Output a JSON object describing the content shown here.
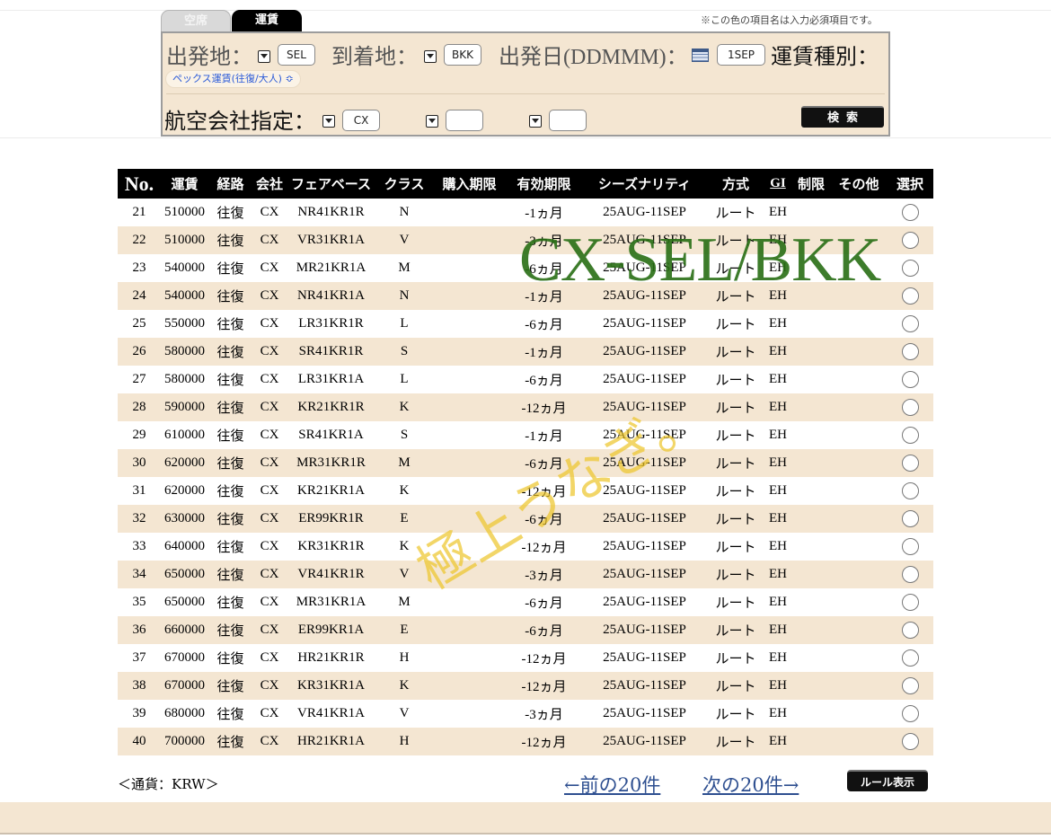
{
  "tabs": {
    "seat": "空席",
    "fare": "運賃"
  },
  "required_note": "※この色の項目名は入力必須項目です。",
  "form": {
    "origin_label": "出発地：",
    "origin_value": "SEL",
    "destination_label": "到着地：",
    "destination_value": "BKK",
    "date_label": "出発日(DDMMM)：",
    "date_value": "1SEP",
    "fare_type_label": "運賃種別：",
    "fare_type_value": "ペックス運賃(往復/大人) ≎",
    "airline_label": "航空会社指定：",
    "airline_1": "CX",
    "airline_2": "",
    "airline_3": "",
    "search_label": "検索"
  },
  "table": {
    "headers": [
      "No.",
      "運賃",
      "経路",
      "会社",
      "フェアベース",
      "クラス",
      "購入期限",
      "有効期限",
      "シーズナリティ",
      "方式",
      "GI",
      "制限",
      "その他",
      "選択"
    ],
    "rows": [
      [
        "21",
        "510000",
        "往復",
        "CX",
        "NR41KR1R",
        "N",
        "",
        "-1ヵ月",
        "25AUG-11SEP",
        "ルート",
        "EH",
        "",
        ""
      ],
      [
        "22",
        "510000",
        "往復",
        "CX",
        "VR31KR1A",
        "V",
        "",
        "-3ヵ月",
        "25AUG-11SEP",
        "ルート",
        "EH",
        "",
        ""
      ],
      [
        "23",
        "540000",
        "往復",
        "CX",
        "MR21KR1A",
        "M",
        "",
        "-6ヵ月",
        "25AUG-11SEP",
        "ルート",
        "EH",
        "",
        ""
      ],
      [
        "24",
        "540000",
        "往復",
        "CX",
        "NR41KR1A",
        "N",
        "",
        "-1ヵ月",
        "25AUG-11SEP",
        "ルート",
        "EH",
        "",
        ""
      ],
      [
        "25",
        "550000",
        "往復",
        "CX",
        "LR31KR1R",
        "L",
        "",
        "-6ヵ月",
        "25AUG-11SEP",
        "ルート",
        "EH",
        "",
        ""
      ],
      [
        "26",
        "580000",
        "往復",
        "CX",
        "SR41KR1R",
        "S",
        "",
        "-1ヵ月",
        "25AUG-11SEP",
        "ルート",
        "EH",
        "",
        ""
      ],
      [
        "27",
        "580000",
        "往復",
        "CX",
        "LR31KR1A",
        "L",
        "",
        "-6ヵ月",
        "25AUG-11SEP",
        "ルート",
        "EH",
        "",
        ""
      ],
      [
        "28",
        "590000",
        "往復",
        "CX",
        "KR21KR1R",
        "K",
        "",
        "-12ヵ月",
        "25AUG-11SEP",
        "ルート",
        "EH",
        "",
        ""
      ],
      [
        "29",
        "610000",
        "往復",
        "CX",
        "SR41KR1A",
        "S",
        "",
        "-1ヵ月",
        "25AUG-11SEP",
        "ルート",
        "EH",
        "",
        ""
      ],
      [
        "30",
        "620000",
        "往復",
        "CX",
        "MR31KR1R",
        "M",
        "",
        "-6ヵ月",
        "25AUG-11SEP",
        "ルート",
        "EH",
        "",
        ""
      ],
      [
        "31",
        "620000",
        "往復",
        "CX",
        "KR21KR1A",
        "K",
        "",
        "-12ヵ月",
        "25AUG-11SEP",
        "ルート",
        "EH",
        "",
        ""
      ],
      [
        "32",
        "630000",
        "往復",
        "CX",
        "ER99KR1R",
        "E",
        "",
        "-6ヵ月",
        "25AUG-11SEP",
        "ルート",
        "EH",
        "",
        ""
      ],
      [
        "33",
        "640000",
        "往復",
        "CX",
        "KR31KR1R",
        "K",
        "",
        "-12ヵ月",
        "25AUG-11SEP",
        "ルート",
        "EH",
        "",
        ""
      ],
      [
        "34",
        "650000",
        "往復",
        "CX",
        "VR41KR1R",
        "V",
        "",
        "-3ヵ月",
        "25AUG-11SEP",
        "ルート",
        "EH",
        "",
        ""
      ],
      [
        "35",
        "650000",
        "往復",
        "CX",
        "MR31KR1A",
        "M",
        "",
        "-6ヵ月",
        "25AUG-11SEP",
        "ルート",
        "EH",
        "",
        ""
      ],
      [
        "36",
        "660000",
        "往復",
        "CX",
        "ER99KR1A",
        "E",
        "",
        "-6ヵ月",
        "25AUG-11SEP",
        "ルート",
        "EH",
        "",
        ""
      ],
      [
        "37",
        "670000",
        "往復",
        "CX",
        "HR21KR1R",
        "H",
        "",
        "-12ヵ月",
        "25AUG-11SEP",
        "ルート",
        "EH",
        "",
        ""
      ],
      [
        "38",
        "670000",
        "往復",
        "CX",
        "KR31KR1A",
        "K",
        "",
        "-12ヵ月",
        "25AUG-11SEP",
        "ルート",
        "EH",
        "",
        ""
      ],
      [
        "39",
        "680000",
        "往復",
        "CX",
        "VR41KR1A",
        "V",
        "",
        "-3ヵ月",
        "25AUG-11SEP",
        "ルート",
        "EH",
        "",
        ""
      ],
      [
        "40",
        "700000",
        "往復",
        "CX",
        "HR21KR1A",
        "H",
        "",
        "-12ヵ月",
        "25AUG-11SEP",
        "ルート",
        "EH",
        "",
        ""
      ]
    ]
  },
  "footer": {
    "currency": "＜通貨：KRW＞",
    "prev_link": "←前の20件",
    "next_link": "次の20件→",
    "rule_button": "ルール表示"
  },
  "overlays": {
    "route_text": "CX-SEL/BKK",
    "shop_text": "極上うなぎ。"
  },
  "colors": {
    "accent_beige": "#f4e6d2",
    "header_black": "#000000",
    "link_blue": "#2e4f90",
    "route_green": "#286e14",
    "watermark_yellow": "#ecc428"
  }
}
